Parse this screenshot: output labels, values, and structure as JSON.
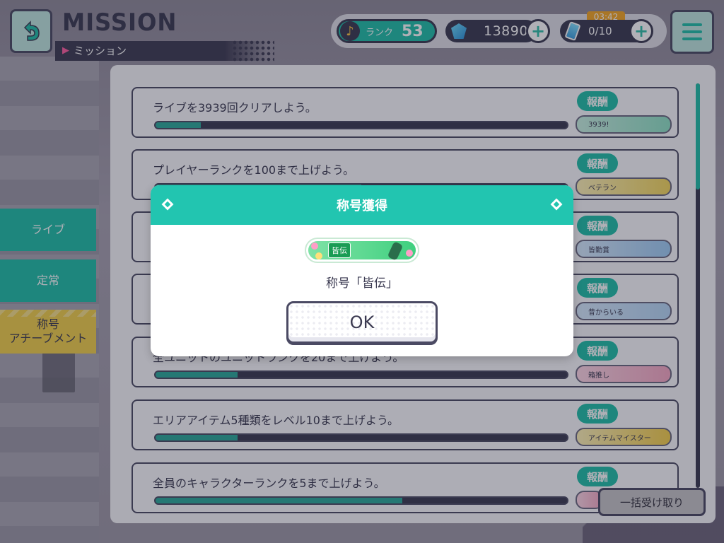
{
  "header": {
    "title": "MISSION",
    "subtitle": "ミッション",
    "rank_label": "ランク",
    "rank_value": "53",
    "gems": "13890",
    "stamina": "0/10",
    "stamina_timer": "03:42"
  },
  "side_tabs": [
    {
      "label": "ライブ"
    },
    {
      "label": "定常"
    },
    {
      "label_line1": "称号",
      "label_line2": "アチーブメント"
    }
  ],
  "missions": [
    {
      "text": "ライブを3939回クリアしよう。",
      "reward_label": "報酬",
      "reward_title": "3939!",
      "progress": 0.11
    },
    {
      "text": "プレイヤーランクを100まで上げよう。",
      "reward_label": "報酬",
      "reward_title": "ベテラン",
      "progress": 0.5
    },
    {
      "text": "",
      "reward_label": "報酬",
      "reward_title": "皆勤賞",
      "progress": 0.5
    },
    {
      "text": "",
      "reward_label": "報酬",
      "reward_title": "昔からいる",
      "progress": 0.5
    },
    {
      "text": "全ユニットのユニットランクを20まで上げよう。",
      "reward_label": "報酬",
      "reward_title": "箱推し",
      "progress": 0.2
    },
    {
      "text": "エリアアイテム5種類をレベル10まで上げよう。",
      "reward_label": "報酬",
      "reward_title": "アイテムマイスター",
      "progress": 0.2
    },
    {
      "text": "全員のキャラクターランクを5まで上げよう。",
      "reward_label": "報酬",
      "reward_title": "",
      "progress": 0.6
    }
  ],
  "bulk_receive_label": "一括受け取り",
  "modal": {
    "title": "称号獲得",
    "title_tag": "皆伝",
    "message": "称号「皆伝」",
    "ok_label": "OK"
  },
  "colors": {
    "accent": "#22c5b0",
    "dark": "#3a3950",
    "achievement_tab": "#f2d04a"
  }
}
